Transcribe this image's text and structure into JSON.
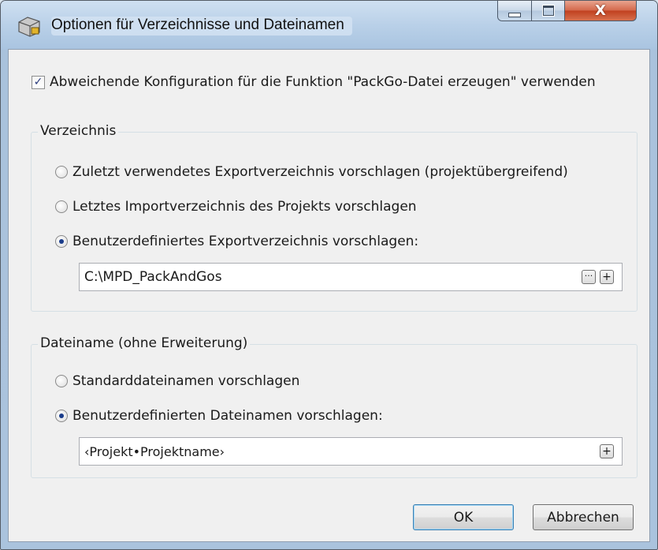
{
  "window": {
    "title": "Optionen für Verzeichnisse und Dateinamen",
    "minimize_glyph": "—",
    "maximize_glyph": "□",
    "close_glyph": "X"
  },
  "config_checkbox": {
    "checked": true,
    "label": "Abweichende Konfiguration für die Funktion \"PackGo-Datei erzeugen\" verwenden"
  },
  "directory_group": {
    "title": "Verzeichnis",
    "options": [
      {
        "label": "Zuletzt verwendetes Exportverzeichnis vorschlagen (projektübergreifend)",
        "selected": false
      },
      {
        "label": "Letztes Importverzeichnis des Projekts vorschlagen",
        "selected": false
      },
      {
        "label": "Benutzerdefiniertes Exportverzeichnis vorschlagen:",
        "selected": true
      }
    ],
    "path_value": "C:\\MPD_PackAndGos",
    "browse_label": "···",
    "add_label": "+"
  },
  "filename_group": {
    "title": "Dateiname (ohne Erweiterung)",
    "options": [
      {
        "label": "Standarddateinamen vorschlagen",
        "selected": false
      },
      {
        "label": "Benutzerdefinierten Dateinamen vorschlagen:",
        "selected": true
      }
    ],
    "name_value": "‹Projekt•Projektname›",
    "add_label": "+"
  },
  "buttons": {
    "ok": "OK",
    "cancel": "Abbrechen"
  }
}
